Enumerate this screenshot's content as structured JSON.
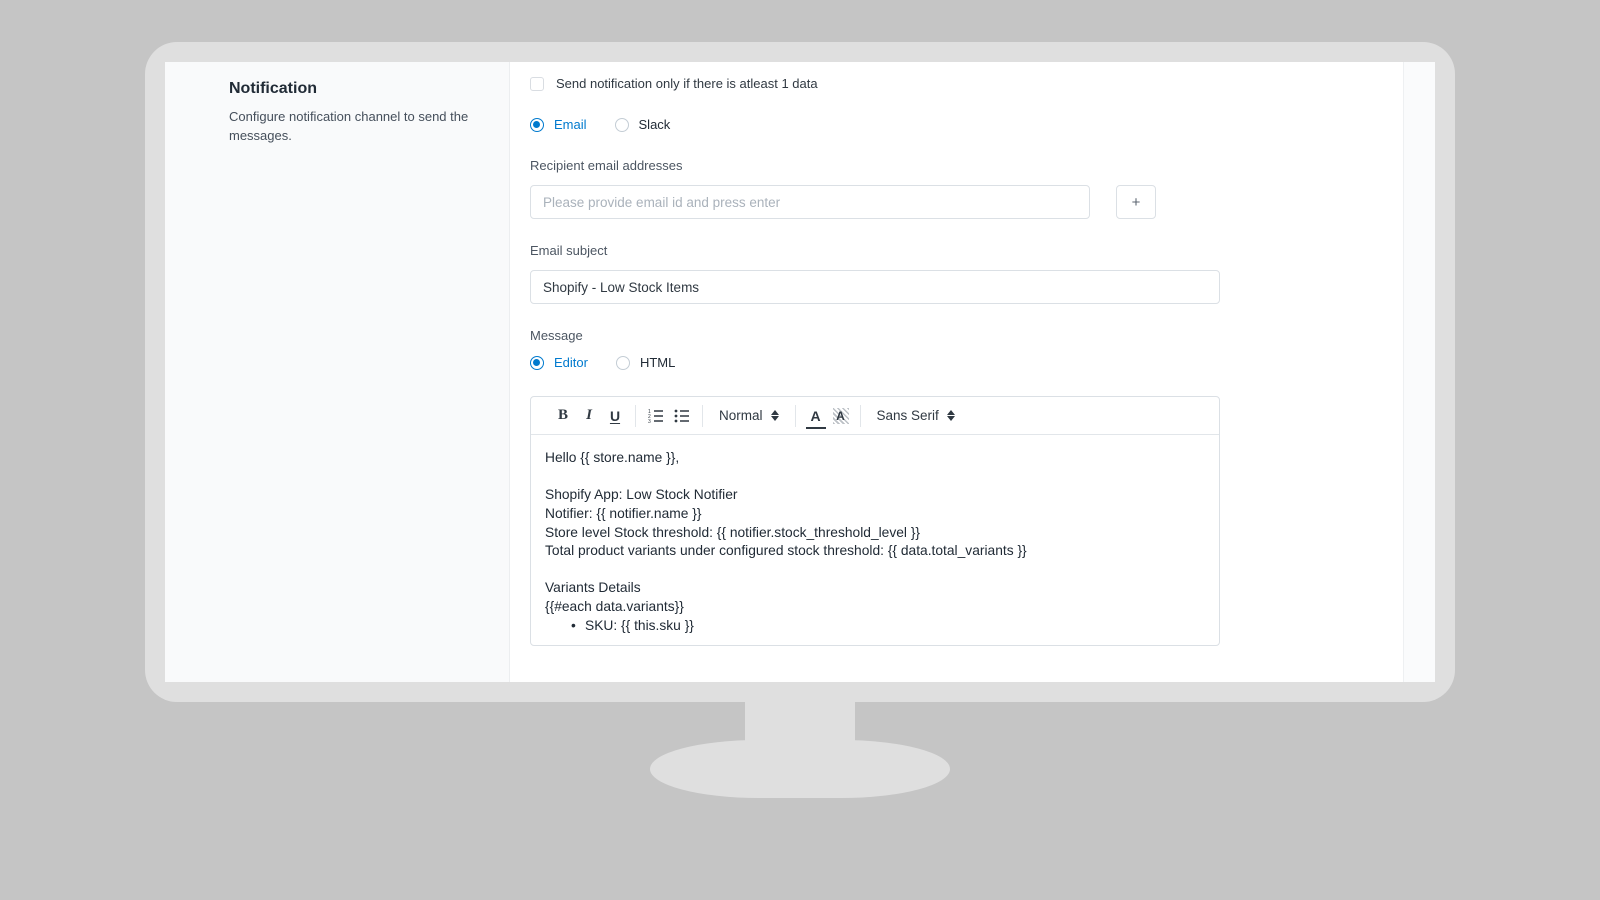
{
  "sidebar": {
    "title": "Notification",
    "description": "Configure notification channel to send the messages."
  },
  "form": {
    "condition_label": "Send notification only if there is atleast 1 data",
    "channel": {
      "options": {
        "email": "Email",
        "slack": "Slack"
      },
      "selected": "email"
    },
    "recipients": {
      "label": "Recipient email addresses",
      "placeholder": "Please provide email id and press enter",
      "add_label": "+"
    },
    "subject": {
      "label": "Email subject",
      "value": "Shopify - Low Stock Items"
    },
    "message": {
      "label": "Message",
      "mode": {
        "options": {
          "editor": "Editor",
          "html": "HTML"
        },
        "selected": "editor"
      },
      "toolbar": {
        "heading": "Normal",
        "font": "Sans Serif"
      },
      "body_lines": [
        "Hello {{ store.name }},",
        "",
        "Shopify App: Low Stock Notifier",
        "Notifier: {{ notifier.name }}",
        "Store level Stock threshold: {{ notifier.stock_threshold_level }}",
        "Total product variants under configured stock threshold: {{ data.total_variants }}",
        "",
        "Variants Details",
        "{{#each data.variants}}"
      ],
      "body_bullet": "SKU: {{ this.sku }}"
    }
  }
}
